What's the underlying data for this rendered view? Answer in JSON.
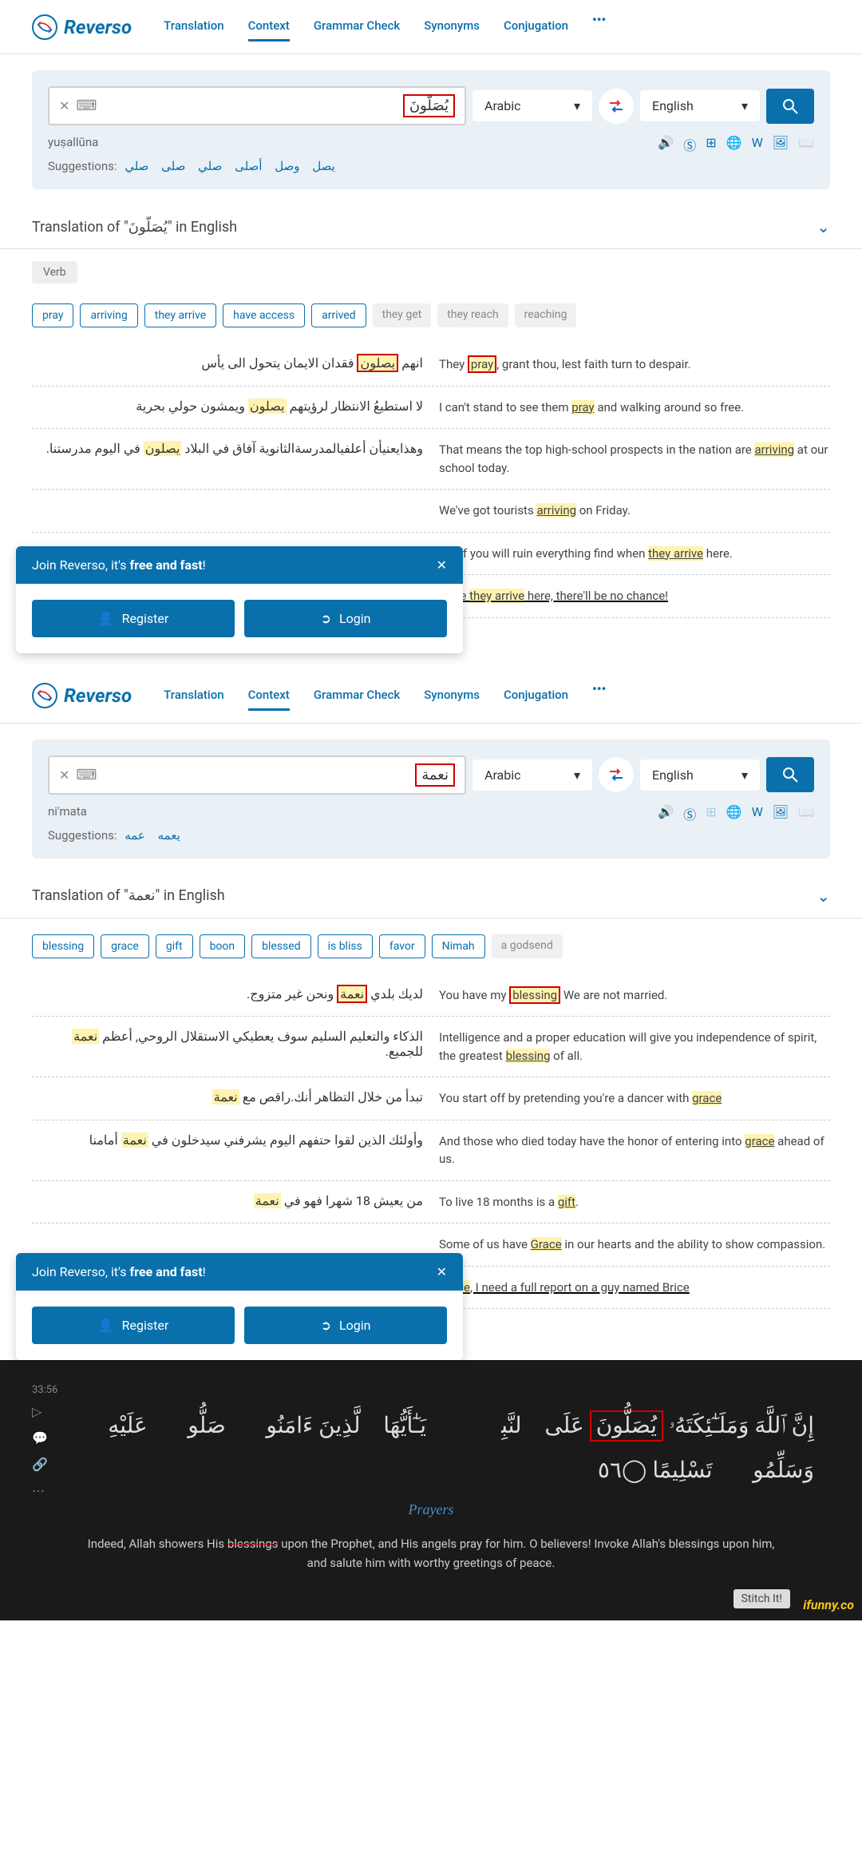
{
  "brand": "Reverso",
  "nav": [
    "Translation",
    "Context",
    "Grammar Check",
    "Synonyms",
    "Conjugation"
  ],
  "section1": {
    "search_term": "يُصَلّونَ",
    "lang_from": "Arabic",
    "lang_to": "English",
    "translit": "yuṣallūna",
    "suggestions_label": "Suggestions:",
    "suggestions": [
      "يصل",
      "وصل",
      "أصلى",
      "صلي",
      "صلى",
      "صلي"
    ],
    "trans_title": "Translation of \"يُصَلّونَ\" in English",
    "pos": "Verb",
    "tags": [
      "pray",
      "arriving",
      "they arrive",
      "have access",
      "arrived"
    ],
    "tags_muted": [
      "they get",
      "they reach",
      "reaching"
    ],
    "examples": [
      {
        "ar": "انهم يصلون فقدان الايمان يتحول الى يأس",
        "ar_hl": "يصلون",
        "en": "They pray, grant thou, lest faith turn to despair.",
        "en_hl": "pray",
        "boxed": true
      },
      {
        "ar": "لا استطيعُ الانتظار لرؤيتهم يصلون ويمشون حولي بحرية",
        "ar_hl": "يصلون",
        "en": "I can't stand to see them pray and walking around so free.",
        "en_hl": "pray"
      },
      {
        "ar": "وهذايعنيأن أعلفيالمدرسةالثانوية آفاق في البلاد يصلون في اليوم مدرستنا.",
        "ar_hl": "يصلون",
        "en": "That means the top high-school prospects in the nation are arriving at our school today.",
        "en_hl": "arriving"
      },
      {
        "ar": "",
        "en": "We've got tourists arriving on Friday.",
        "en_hl": "arriving"
      },
      {
        "ar": "",
        "en": "But if you will ruin everything find when they arrive here.",
        "en_hl": "they arrive"
      },
      {
        "ar": "",
        "en": "Once they arrive here, there'll be no chance!",
        "en_hl": "they arrive",
        "underline": true
      }
    ],
    "join_title_pre": "Join Reverso, it's ",
    "join_title_bold": "free and fast",
    "register": "Register",
    "login": "Login"
  },
  "section2": {
    "search_term": "نعمة",
    "lang_from": "Arabic",
    "lang_to": "English",
    "translit": "ni'mata",
    "suggestions_label": "Suggestions:",
    "suggestions": [
      "يعمه",
      "عمه"
    ],
    "trans_title": "Translation of \"نعمة\" in English",
    "tags": [
      "blessing",
      "grace",
      "gift",
      "boon",
      "blessed",
      "is bliss",
      "favor",
      "Nimah"
    ],
    "tags_muted": [
      "a godsend"
    ],
    "examples": [
      {
        "ar": "لديك بلدي نعمة ونحن غير متزوج.",
        "ar_hl": "نعمة",
        "en_pre": "You have my ",
        "en_hl": "blessing",
        "en_post": " We are not married.",
        "boxed": true
      },
      {
        "ar": "الذكاء والتعليم السليم سوف يعطيكي الاستقلال الروحي, أعظم نعمة للجميع.",
        "ar_hl": "نعمة",
        "en": "Intelligence and a proper education will give you independence of spirit, the greatest blessing of all.",
        "en_hl": "blessing"
      },
      {
        "ar": "تبدأ من خلال التظاهر أنك.راقص مع نعمة",
        "ar_hl": "نعمة",
        "en": "You start off by pretending you're a dancer with grace",
        "en_hl": "grace"
      },
      {
        "ar": "وأولئك الذين لقوا حتفهم اليوم يشرفني سيدخلون في نعمة أمامنا",
        "ar_hl": "نعمة",
        "en": "And those who died today have the honor of entering into grace ahead of us.",
        "en_hl": "grace"
      },
      {
        "ar": "من يعيش 18 شهرا فهو في نعمة",
        "ar_hl": "نعمة",
        "en": "To live 18 months is a gift.",
        "en_hl": "gift"
      },
      {
        "ar": "",
        "en": "Some of us have Grace in our hearts and the ability to show compassion.",
        "en_hl": "Grace"
      },
      {
        "ar": "",
        "en": "Grace, I need a full report on a guy named Brice",
        "en_hl": "Grace",
        "underline": true
      }
    ],
    "join_title_pre": "Join Reverso, it's ",
    "join_title_bold": "free and fast",
    "register": "Register",
    "login": "Login"
  },
  "dark": {
    "time": "33:56",
    "verse": "إِنَّ ٱللَّهَ وَمَلَـٰٓئِكَتَهُۥ يُصَلُّونَ عَلَى ٱلنَّبِيِّۚ يَـٰٓأَيُّهَا ٱلَّذِينَ ءَامَنُوا۟ صَلُّوا۟ عَلَيْهِ وَسَلِّمُوا۟ تَسْلِيمًا ◯٥٦",
    "verse_boxed": "يُصَلُّونَ",
    "note": "Prayers",
    "trans": "Indeed, Allah showers His blessings upon the Prophet, and His angels pray for him. O  believers! Invoke Allah's blessings upon him, and salute him with worthy greetings of peace.",
    "strike_word": "blessings",
    "stitch": "Stitch It!",
    "ifunny": "ifunny.co"
  }
}
